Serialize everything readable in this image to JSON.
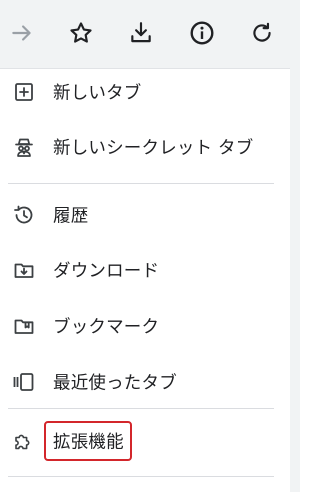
{
  "toolbar": {
    "buttons": [
      {
        "name": "forward",
        "icon": "arrow-right-icon",
        "enabled": false
      },
      {
        "name": "bookmark",
        "icon": "star-icon",
        "enabled": true
      },
      {
        "name": "download",
        "icon": "download-icon",
        "enabled": true
      },
      {
        "name": "info",
        "icon": "info-icon",
        "enabled": true
      },
      {
        "name": "reload",
        "icon": "reload-icon",
        "enabled": true
      }
    ]
  },
  "menu": {
    "items": [
      {
        "label": "新しいタブ",
        "icon": "new-tab-icon"
      },
      {
        "label": "新しいシークレット タブ",
        "icon": "incognito-icon"
      },
      {
        "label": "履歴",
        "icon": "history-icon"
      },
      {
        "label": "ダウンロード",
        "icon": "downloads-folder-icon"
      },
      {
        "label": "ブックマーク",
        "icon": "bookmarks-folder-icon"
      },
      {
        "label": "最近使ったタブ",
        "icon": "recent-tabs-icon"
      },
      {
        "label": "拡張機能",
        "icon": "extension-puzzle-icon"
      }
    ]
  },
  "colors": {
    "toolbar_bg": "#f1f3f4",
    "text": "#202124",
    "icon": "#3c4043",
    "disabled_icon": "#9aa0a6",
    "highlight_border": "#d3262b",
    "divider": "#dadce0"
  }
}
